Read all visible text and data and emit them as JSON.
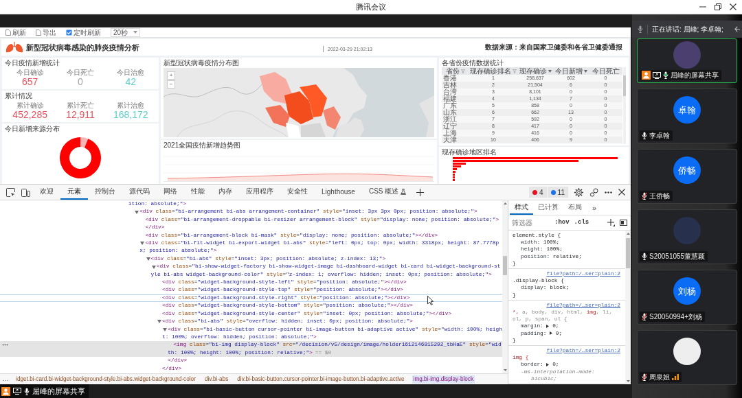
{
  "window": {
    "title": "腾讯会议"
  },
  "shared_screen": {
    "dashboard": {
      "toolbar": [
        {
          "kind": "button",
          "label": "刷新"
        },
        {
          "kind": "button",
          "label": "导出"
        },
        {
          "kind": "checkbox",
          "label": "定时刷新",
          "checked": true
        },
        {
          "kind": "dropdown",
          "value": "20秒"
        }
      ],
      "title": "新型冠状病毒感染的肺炎疫情分析",
      "updated": "2022-03-29 21:02:13",
      "source": "数据来源：来自国家卫健委和各省卫健委通报",
      "stat_cards": [
        {
          "title": "今日疫情新增统计",
          "stats": [
            {
              "label": "今日确诊",
              "value": "657",
              "color": "#e8505b"
            },
            {
              "label": "今日死亡",
              "value": "0",
              "color": "#a3a3a3"
            },
            {
              "label": "今日治愈",
              "value": "42",
              "color": "#5ccfca"
            }
          ]
        },
        {
          "title": "累计情况",
          "stats": [
            {
              "label": "累计确诊",
              "value": "452,285",
              "color": "#e8505b"
            },
            {
              "label": "累计死亡",
              "value": "12,911",
              "color": "#e8505b"
            },
            {
              "label": "累计治愈",
              "value": "168,172",
              "color": "#5ccfca"
            }
          ]
        }
      ],
      "source_chart": {
        "title": "今日新增来源分布"
      },
      "map": {
        "title": "新型冠状病毒疫情分布图",
        "zoom_buttons": [
          "+",
          "−"
        ]
      },
      "trend_chart": {
        "title": "2021全国疫情新增趋势图"
      },
      "province_table": {
        "title": "各省份疫情数据统计",
        "columns": [
          {
            "label": "省份",
            "kind": "filter"
          },
          {
            "label": "现存确诊排名",
            "kind": "filter"
          },
          {
            "label": "现存确诊",
            "kind": "sort"
          },
          {
            "label": "今日新增",
            "kind": "sort"
          },
          {
            "label": "今日死亡",
            "kind": "plain"
          }
        ],
        "rows": [
          [
            "香港",
            "1",
            "258,637",
            "602",
            "0"
          ],
          [
            "吉林",
            "2",
            "21,504",
            "6",
            "0"
          ],
          [
            "台湾",
            "3",
            "8,101",
            "0",
            "0"
          ],
          [
            "福建",
            "4",
            "1,134",
            "7",
            "0"
          ],
          [
            "广东",
            "5",
            "858",
            "0",
            "0"
          ],
          [
            "山东",
            "6",
            "662",
            "13",
            "0"
          ],
          [
            "浙江",
            "7",
            "592",
            "0",
            "0"
          ],
          [
            "辽宁",
            "8",
            "417",
            "0",
            "0"
          ],
          [
            "上海",
            "9",
            "416",
            "0",
            "0"
          ],
          [
            "天津",
            "10",
            "406",
            "9",
            "0"
          ]
        ]
      },
      "ranking_chart": {
        "title": "现存确诊地区排名"
      }
    },
    "devtools": {
      "tabs": [
        {
          "label": "欢迎",
          "selected": false,
          "experimental": false
        },
        {
          "label": "元素",
          "selected": true,
          "experimental": false
        },
        {
          "label": "控制台",
          "selected": false,
          "experimental": false
        },
        {
          "label": "源代码",
          "selected": false,
          "experimental": false
        },
        {
          "label": "网络",
          "selected": false,
          "experimental": false
        },
        {
          "label": "性能",
          "selected": false,
          "experimental": false
        },
        {
          "label": "内存",
          "selected": false,
          "experimental": false
        },
        {
          "label": "应用程序",
          "selected": false,
          "experimental": false
        },
        {
          "label": "安全性",
          "selected": false,
          "experimental": false
        },
        {
          "label": "Lighthouse",
          "selected": false,
          "experimental": false
        },
        {
          "label": "CSS 概述",
          "selected": false,
          "experimental": true
        }
      ],
      "issues": [
        {
          "kind": "error",
          "count": "4"
        },
        {
          "kind": "info",
          "count": "11"
        }
      ],
      "dom_tree": [
        {
          "kind": "fragment",
          "text": "ition: absolute;\">",
          "selected": false,
          "hovered": false,
          "children": [
            {
              "kind": "element",
              "text": "<div class=\"bi-arrangement bi-abs arrangement-container\" style=\"inset: 3px 3px 0px; position: absolute;\">",
              "expanded": true,
              "selected": false,
              "hovered": false,
              "children": [
                {
                  "kind": "element",
                  "text": "<div class=\"bi-arrangement-droppable bi-resizer arrangement-block\" style=\"display: none; position: absolute;\">",
                  "close": "</div>",
                  "selected": false,
                  "hovered": false
                },
                {
                  "kind": "element",
                  "text": "<div class=\"bi-arrangement-block bi-mask\" style=\"display: none; position: absolute;\"></div>",
                  "selected": false,
                  "hovered": false
                },
                {
                  "kind": "element",
                  "text": "<div class=\"bi-fit-widget bi-export-widget bi-abs\" style=\"left: 0px; top: 0px; width: 3318px; height: 87.7778px; position: absolute;\">",
                  "expanded": true,
                  "selected": false,
                  "hovered": false,
                  "children": [
                    {
                      "kind": "element",
                      "text": "<div class=\"bi-abs\" style=\"inset: 3px; position: absolute; z-index: 13;\">",
                      "expanded": true,
                      "selected": false,
                      "hovered": false,
                      "children": [
                        {
                          "kind": "element",
                          "text": "<div class=\"bi-show-widget-factory bi-show-widget-image bi-dashboard-widget bi-card bi-widget-background-style bi-abs widget-background-color\" style=\"z-index: 1; overflow: hidden; inset: 0px; position: absolute;\">",
                          "expanded": true,
                          "selected": false,
                          "hovered": false,
                          "children": [
                            {
                              "kind": "element",
                              "text": "<div class=\"widget-background-style-left\" style=\"position: absolute;\"></div>",
                              "selected": false,
                              "hovered": false
                            },
                            {
                              "kind": "element",
                              "text": "<div class=\"widget-background-style-top\" style=\"position: absolute;\"></div>",
                              "selected": false,
                              "hovered": false
                            },
                            {
                              "kind": "element",
                              "text": "<div class=\"widget-background-style-right\" style=\"position: absolute;\"></div>",
                              "selected": false,
                              "hovered": true
                            },
                            {
                              "kind": "element",
                              "text": "<div class=\"widget-background-style-bottom\" style=\"position: absolute;\"></div>",
                              "selected": false,
                              "hovered": false
                            },
                            {
                              "kind": "element",
                              "text": "<div class=\"widget-background-style-center\" style=\"inset: 0px; position: absolute;\"></div>",
                              "selected": false,
                              "hovered": false
                            },
                            {
                              "kind": "element",
                              "text": "<div class=\"bi-abs\" style=\"overflow: hidden; inset: 0px; position: absolute;\">",
                              "expanded": true,
                              "close": "</div>",
                              "selected": false,
                              "hovered": false,
                              "children": [
                                {
                                  "kind": "element",
                                  "text": "<div class=\"bi-basic-button cursor-pointer bi-image-button bi-adaptive active\" style=\"width: 100%; height: 100%; overflow: hidden; position: absolute;\">",
                                  "expanded": true,
                                  "close": "</div>",
                                  "selected": false,
                                  "hovered": false,
                                  "children": [
                                    {
                                      "kind": "element",
                                      "text": "<img class=\"bi-img display-block\" src=\"/decision/v5/design/image/holder1612146815292_tbHaE\" style=\"width: 100%; height: 100%; position: relative;\">",
                                      "suffix": "== $0",
                                      "selected": true,
                                      "hovered": false
                                    }
                                  ]
                                }
                              ]
                            }
                          ]
                        }
                      ]
                    }
                  ]
                }
              ]
            }
          ]
        }
      ],
      "breadcrumbs": {
        "overflow": "…",
        "items": [
          {
            "label": "idget.bi-card.bi-widget-background-style.bi-abs.widget-background-color",
            "selected": false
          },
          {
            "label": "div.bi-abs",
            "selected": false
          },
          {
            "label": "div.bi-basic-button.cursor-pointer.bi-image-button.bi-adaptive.active",
            "selected": false
          },
          {
            "label": "img.bi-img.display-block",
            "selected": true
          }
        ]
      },
      "styles": {
        "tabs": [
          {
            "label": "样式",
            "selected": true
          },
          {
            "label": "已计算",
            "selected": false
          },
          {
            "label": "布局",
            "selected": false
          }
        ],
        "more": "»",
        "filter": {
          "placeholder": "筛选器"
        },
        "toggles": [
          ":hov",
          ".cls"
        ],
        "rules": [
          {
            "selector": [
              {
                "text": "element.style {",
                "kind": "plain"
              }
            ],
            "properties": [
              {
                "name": "width:",
                "value": "100%;",
                "expandable": false,
                "overridden": false
              },
              {
                "name": "height:",
                "value": "100%;",
                "expandable": false,
                "overridden": false
              },
              {
                "name": "position:",
                "value": "relative;",
                "expandable": false,
                "overridden": false
              }
            ],
            "close": "}"
          },
          {
            "selector": [
              {
                "text": ".display-block {",
                "kind": "plain"
              }
            ],
            "source": "file?path=/…ser=plain:2",
            "properties": [
              {
                "name": "display:",
                "value": "block;",
                "expandable": false,
                "overridden": false
              }
            ],
            "close": "}"
          },
          {
            "selector": [
              {
                "text": "*,",
                "kind": "matched"
              },
              {
                "text": " a, body, div, html, ",
                "kind": "unmatched"
              },
              {
                "text": "img",
                "kind": "matched"
              },
              {
                "text": ", li, ol, p, span, ul {",
                "kind": "unmatched"
              }
            ],
            "source": "file?path=/…ser=plain:2",
            "properties": [
              {
                "name": "margin:",
                "value": "0;",
                "expandable": true,
                "overridden": false
              },
              {
                "name": "padding:",
                "value": "0;",
                "expandable": true,
                "overridden": false
              }
            ],
            "close": "}"
          },
          {
            "selector": [
              {
                "text": "img {",
                "kind": "matched"
              }
            ],
            "source": "file?path=/…ser=plain:2",
            "properties": [
              {
                "name": "border:",
                "value": "0;",
                "expandable": true,
                "overridden": false
              },
              {
                "name": "-ms-interpolation-mode:",
                "value": "bicubic;",
                "expandable": false,
                "overridden": true
              }
            ]
          }
        ]
      }
    }
  },
  "share_banner": {
    "label": "屈峰的屏幕共享",
    "muted": false
  },
  "sidebar": {
    "speaking": "正在讲话: 屈峰; 李卓翰;",
    "participants": [
      {
        "name": "屈峰的屏幕共享",
        "avatar": {
          "kind": "picture",
          "color": "#4a3f6e"
        },
        "muted": false,
        "voice_activity": true,
        "host": true,
        "sharing": true,
        "weak_signal": false,
        "selected": true
      },
      {
        "name": "李卓翰",
        "avatar": {
          "kind": "initials",
          "text": "卓翰"
        },
        "muted": false,
        "voice_activity": false,
        "host": false,
        "sharing": false,
        "weak_signal": false,
        "selected": false
      },
      {
        "name": "王侨畅",
        "avatar": {
          "kind": "initials",
          "text": "侨畅"
        },
        "muted": true,
        "voice_activity": false,
        "host": false,
        "sharing": false,
        "weak_signal": false,
        "selected": false
      },
      {
        "name": "S20051055董慧颖",
        "avatar": {
          "kind": "picture",
          "color": "#27304d"
        },
        "muted": false,
        "voice_activity": false,
        "host": false,
        "sharing": false,
        "weak_signal": false,
        "selected": false
      },
      {
        "name": "S20050994+刘杨",
        "avatar": {
          "kind": "initials",
          "text": "刘杨"
        },
        "muted": true,
        "voice_activity": false,
        "host": false,
        "sharing": false,
        "weak_signal": false,
        "selected": false
      },
      {
        "name": "周泉姐",
        "avatar": {
          "kind": "picture",
          "color": "#eeeeee"
        },
        "muted": true,
        "voice_activity": false,
        "host": false,
        "sharing": false,
        "weak_signal": true,
        "selected": false
      }
    ]
  }
}
